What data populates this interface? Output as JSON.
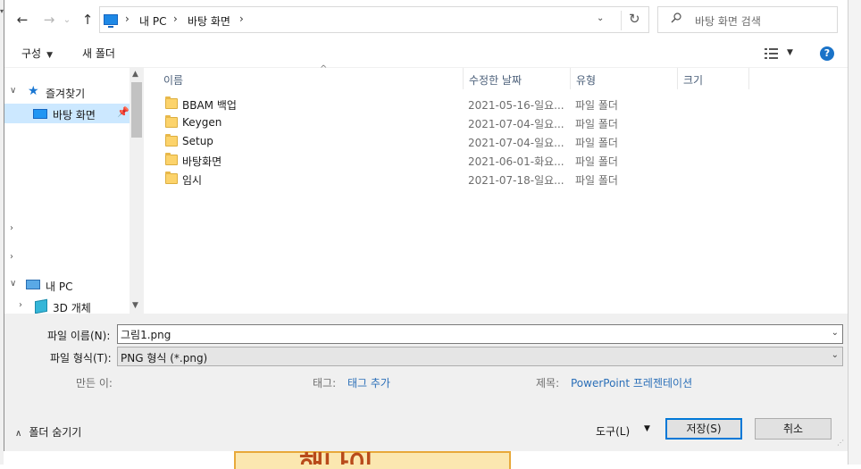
{
  "address": {
    "crumbs": [
      "내 PC",
      "바탕 화면"
    ]
  },
  "search": {
    "placeholder": "바탕 화면 검색"
  },
  "toolbar": {
    "organize_label": "구성",
    "new_folder_label": "새 폴더"
  },
  "nav": {
    "quick_access": "즐겨찾기",
    "desktop": "바탕 화면",
    "this_pc": "내 PC",
    "objects_3d": "3D 개체"
  },
  "columns": {
    "name": "이름",
    "date": "수정한 날짜",
    "type": "유형",
    "size": "크기"
  },
  "files": [
    {
      "name": "BBAM 백업",
      "date": "2021-05-16-일요...",
      "type": "파일 폴더"
    },
    {
      "name": "Keygen",
      "date": "2021-07-04-일요...",
      "type": "파일 폴더"
    },
    {
      "name": "Setup",
      "date": "2021-07-04-일요...",
      "type": "파일 폴더"
    },
    {
      "name": "바탕화면",
      "date": "2021-06-01-화요...",
      "type": "파일 폴더"
    },
    {
      "name": "임시",
      "date": "2021-07-18-일요...",
      "type": "파일 폴더"
    }
  ],
  "form": {
    "filename_label": "파일 이름(N):",
    "filename_value": "그림1.png",
    "filetype_label": "파일 형식(T):",
    "filetype_value": "PNG 형식 (*.png)",
    "authors_label": "만든 이:",
    "tags_label": "태그:",
    "tags_value": "태그 추가",
    "title_label": "제목:",
    "title_value": "PowerPoint 프레젠테이션"
  },
  "footer": {
    "hide_folders": "폴더 숨기기",
    "tools": "도구(L)",
    "save": "저장(S)",
    "cancel": "취소"
  },
  "background": {
    "partial_text": "해나이"
  },
  "colors": {
    "accent": "#0078d7",
    "link": "#2b6fb8",
    "selection": "#cce8ff",
    "folder": "#fcd36b"
  }
}
